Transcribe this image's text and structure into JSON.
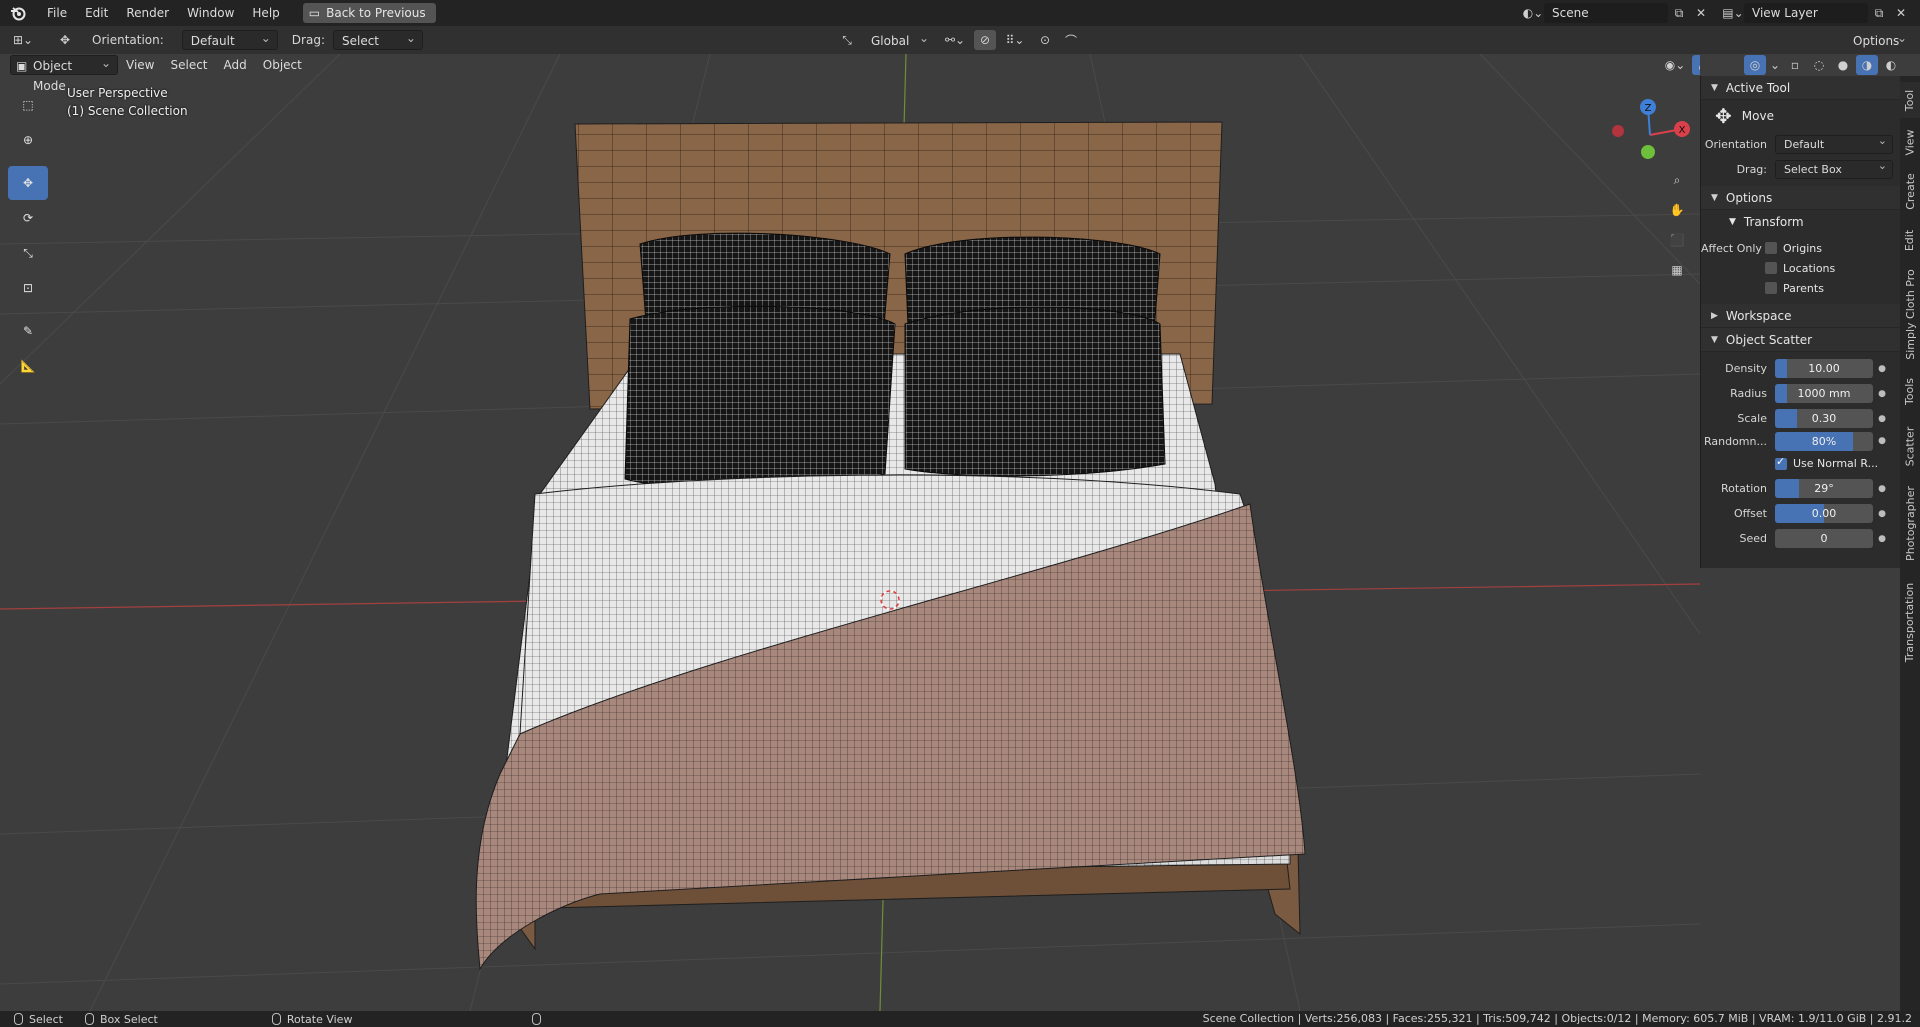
{
  "topbar": {
    "menu": [
      "File",
      "Edit",
      "Render",
      "Window",
      "Help"
    ],
    "back_button": "Back to Previous",
    "scene": "Scene",
    "view_layer": "View Layer"
  },
  "toolheader": {
    "orientation_label": "Orientation:",
    "orientation_value": "Default",
    "drag_label": "Drag:",
    "drag_value": "Select Box",
    "transform_space": "Global",
    "options_label": "Options"
  },
  "viewheader": {
    "mode": "Object Mode",
    "menu": [
      "View",
      "Select",
      "Add",
      "Object"
    ]
  },
  "viewport": {
    "perspective_label": "User Perspective",
    "collection_label": "(1) Scene Collection",
    "gizmo_axes": {
      "x": "X",
      "y": "Y",
      "z": "Z"
    },
    "colors": {
      "x_axis": "#d9404a",
      "y_axis": "#6fbf3b",
      "z_axis": "#3e7fd8",
      "floor_x_line": "#a3403f",
      "floor_y_line": "#6e8f3a"
    }
  },
  "tools": [
    {
      "name": "select-box-tool",
      "icon": "select-box-icon"
    },
    {
      "name": "cursor-tool",
      "icon": "cursor-icon"
    },
    {
      "name": "move-tool",
      "icon": "move-icon",
      "active": true
    },
    {
      "name": "rotate-tool",
      "icon": "rotate-icon"
    },
    {
      "name": "scale-tool",
      "icon": "scale-icon"
    },
    {
      "name": "transform-tool",
      "icon": "transform-icon"
    },
    {
      "name": "annotate-tool",
      "icon": "annotate-icon"
    },
    {
      "name": "measure-tool",
      "icon": "measure-icon"
    }
  ],
  "npanel": {
    "active_tool_header": "Active Tool",
    "tool_name": "Move",
    "orientation_label": "Orientation",
    "orientation_value": "Default",
    "drag_label": "Drag:",
    "drag_value": "Select Box",
    "options_header": "Options",
    "transform_header": "Transform",
    "affect_only_label": "Affect Only",
    "affect_only": [
      "Origins",
      "Locations",
      "Parents"
    ],
    "workspace_header": "Workspace",
    "object_scatter_header": "Object Scatter",
    "scatter": {
      "density_label": "Density",
      "density_value": "10.00",
      "density_fill": 0.12,
      "radius_label": "Radius",
      "radius_value": "1000 mm",
      "radius_fill": 0.12,
      "scale_label": "Scale",
      "scale_value": "0.30",
      "scale_fill": 0.22,
      "random_label": "Randomn...",
      "random_value": "80%",
      "random_fill": 0.8,
      "use_normal_label": "Use Normal R...",
      "use_normal_checked": true,
      "rotation_label": "Rotation",
      "rotation_value": "29°",
      "rotation_fill": 0.24,
      "offset_label": "Offset",
      "offset_value": "0.00",
      "offset_fill": 0.5,
      "seed_label": "Seed",
      "seed_value": "0"
    }
  },
  "vtabs": [
    "Tool",
    "View",
    "Create",
    "Edit",
    "Simply Cloth Pro",
    "Tools",
    "Scatter",
    "Photographer",
    "Transportation"
  ],
  "statusbar": {
    "select": "Select",
    "box_select": "Box Select",
    "rotate_view": "Rotate View",
    "stats": "Scene Collection | Verts:256,083 | Faces:255,321 | Tris:509,742 | Objects:0/12 | Memory: 605.7 MiB | VRAM: 1.9/11.0 GiB | 2.91.2"
  }
}
